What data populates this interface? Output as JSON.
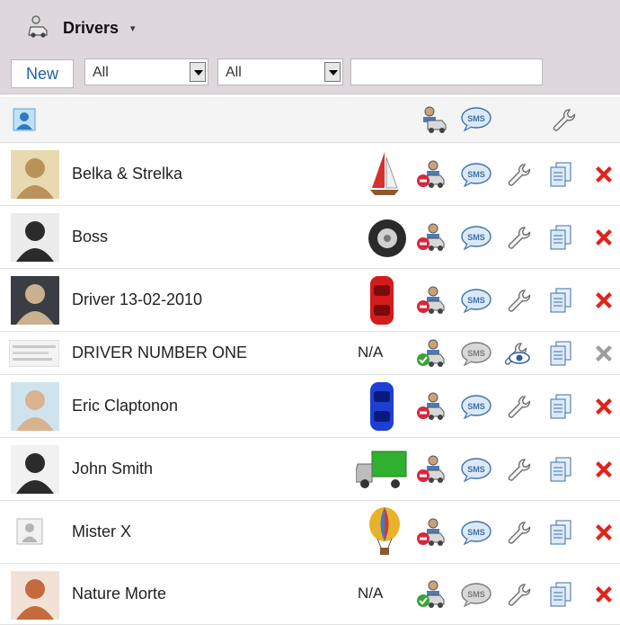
{
  "header": {
    "title": "Drivers",
    "caret": "▾",
    "icon": "driver-car-icon"
  },
  "toolbar": {
    "new_label": "New",
    "filter1": {
      "value": "All"
    },
    "filter2": {
      "value": "All"
    },
    "search": {
      "value": "",
      "placeholder": ""
    }
  },
  "columns": [
    "avatar",
    "driver-status-icon",
    "sms-icon",
    "wrench-icon"
  ],
  "sms_text": "SMS",
  "drivers": [
    {
      "name": "Belka & Strelka",
      "vehicle": "N/A-hidden",
      "vehicle_icon": "sailboat-icon",
      "driver_status": "offline",
      "access": "wrench",
      "delete": "enabled"
    },
    {
      "name": "Boss",
      "vehicle_icon": "tire-icon",
      "driver_status": "offline",
      "access": "wrench",
      "delete": "enabled"
    },
    {
      "name": "Driver 13-02-2010",
      "vehicle_icon": "red-car-icon",
      "driver_status": "offline",
      "access": "wrench",
      "delete": "enabled"
    },
    {
      "name": "DRIVER NUMBER ONE",
      "vehicle_text": "N/A",
      "driver_status": "online",
      "access": "eye-wrench",
      "delete": "disabled"
    },
    {
      "name": "Eric Claptonon",
      "vehicle_icon": "blue-car-icon",
      "driver_status": "offline",
      "access": "wrench",
      "delete": "enabled"
    },
    {
      "name": "John Smith",
      "vehicle_icon": "green-truck-icon",
      "driver_status": "offline",
      "access": "wrench",
      "delete": "enabled"
    },
    {
      "name": "Mister X",
      "vehicle_icon": "hot-air-balloon-icon",
      "driver_status": "offline",
      "access": "wrench",
      "delete": "enabled"
    },
    {
      "name": "Nature Morte",
      "vehicle_text": "N/A",
      "driver_status": "online",
      "access": "wrench",
      "delete": "enabled"
    }
  ],
  "colors": {
    "delete_red": "#e0241b",
    "online_green": "#3aa43a",
    "offline_red": "#d7263d",
    "link_blue": "#1f63a8"
  }
}
